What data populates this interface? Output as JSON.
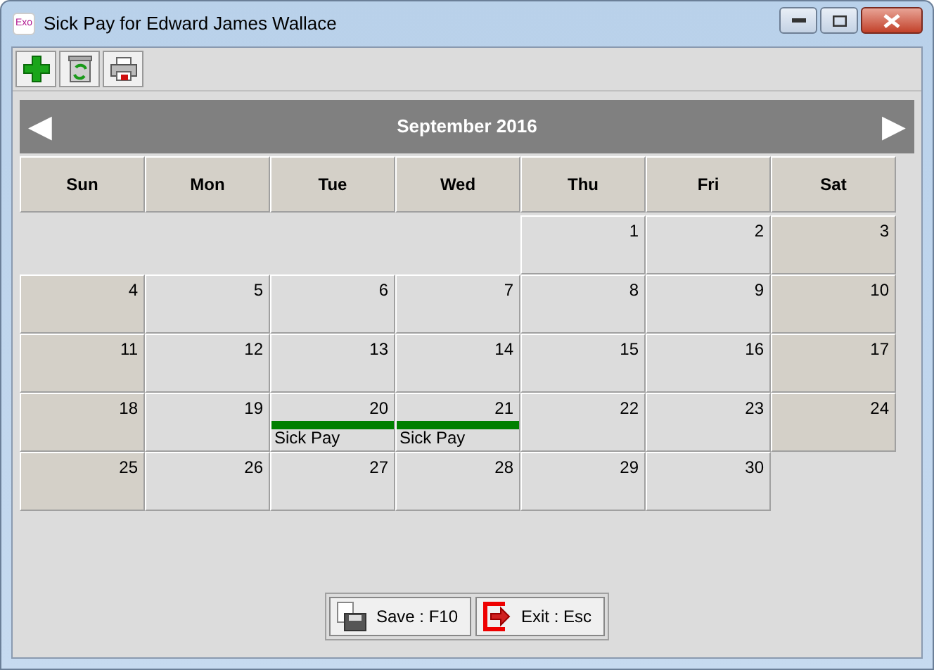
{
  "window": {
    "title": "Sick Pay for Edward James Wallace",
    "app_icon": "Exo"
  },
  "toolbar": [
    {
      "kind": "add"
    },
    {
      "kind": "recycle"
    },
    {
      "kind": "print"
    }
  ],
  "calendar": {
    "month": "September 2016",
    "prev": "◀",
    "next": "▶",
    "weekdays": [
      "Sun",
      "Mon",
      "Tue",
      "Wed",
      "Thu",
      "Fri",
      "Sat"
    ],
    "weeks": [
      [
        {
          "kind": "blank"
        },
        {
          "kind": "blank"
        },
        {
          "kind": "blank"
        },
        {
          "kind": "blank"
        },
        {
          "day": "1",
          "weekend": false
        },
        {
          "day": "2",
          "weekend": false
        },
        {
          "day": "3",
          "weekend": true
        }
      ],
      [
        {
          "day": "4",
          "weekend": true
        },
        {
          "day": "5",
          "weekend": false
        },
        {
          "day": "6",
          "weekend": false
        },
        {
          "day": "7",
          "weekend": false
        },
        {
          "day": "8",
          "weekend": false
        },
        {
          "day": "9",
          "weekend": false
        },
        {
          "day": "10",
          "weekend": true
        }
      ],
      [
        {
          "day": "11",
          "weekend": true
        },
        {
          "day": "12",
          "weekend": false
        },
        {
          "day": "13",
          "weekend": false
        },
        {
          "day": "14",
          "weekend": false
        },
        {
          "day": "15",
          "weekend": false
        },
        {
          "day": "16",
          "weekend": false
        },
        {
          "day": "17",
          "weekend": true
        }
      ],
      [
        {
          "day": "18",
          "weekend": true
        },
        {
          "day": "19",
          "weekend": false
        },
        {
          "day": "20",
          "weekend": false,
          "events": [
            {
              "label": "Sick Pay",
              "color": "#008000"
            }
          ]
        },
        {
          "day": "21",
          "weekend": false,
          "events": [
            {
              "label": "Sick Pay",
              "color": "#008000"
            }
          ]
        },
        {
          "day": "22",
          "weekend": false
        },
        {
          "day": "23",
          "weekend": false
        },
        {
          "day": "24",
          "weekend": true
        }
      ],
      [
        {
          "day": "25",
          "weekend": true
        },
        {
          "day": "26",
          "weekend": false
        },
        {
          "day": "27",
          "weekend": false
        },
        {
          "day": "28",
          "weekend": false
        },
        {
          "day": "29",
          "weekend": false
        },
        {
          "day": "30",
          "weekend": false
        },
        {
          "kind": "blank"
        }
      ]
    ]
  },
  "buttons": [
    {
      "kind": "save",
      "label": "Save : F10"
    },
    {
      "kind": "exit",
      "label": "Exit : Esc"
    }
  ]
}
